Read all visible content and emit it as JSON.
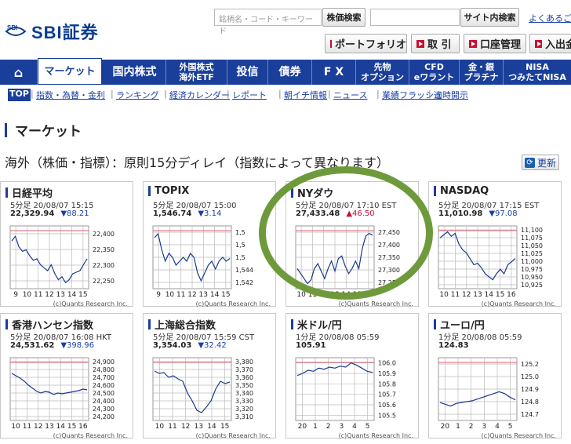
{
  "header": {
    "logo_text": "SBI証券",
    "logo_mark_text": "SBI",
    "search_placeholder": "銘柄名・コード・キーワード",
    "stock_search_button": "株価検索",
    "site_search_button": "サイト内検索",
    "link_text": "よくあるご",
    "quick_buttons": [
      "ポートフォリオ",
      "取 引",
      "口座管理",
      "入出金"
    ]
  },
  "nav": {
    "tabs": [
      {
        "label": "⌂"
      },
      {
        "label": "マーケット"
      },
      {
        "label": "国内株式"
      },
      {
        "label": "外国株式\n海外ETF"
      },
      {
        "label": "投信"
      },
      {
        "label": "債券"
      },
      {
        "label": "F X"
      },
      {
        "label": "先物\nオプション"
      },
      {
        "label": "CFD\neワラント"
      },
      {
        "label": "金・銀\nプラチナ"
      },
      {
        "label": "NISA\nつみたてNISA"
      }
    ],
    "subtabs": [
      "TOP",
      "指数・為替・金利",
      "ランキング",
      "経済カレンダー",
      "レポート",
      "朝イチ情報",
      "ニュース",
      "業績フラッシュ",
      "適時開示"
    ]
  },
  "section": {
    "title": "マーケット",
    "note": "海外（株価・指標）：原則15分ディレイ（指数によって異なります）",
    "update_button": "更新"
  },
  "colors": {
    "nav": "#1a3f9a",
    "down": "#1a3fa8",
    "up": "#c8102e",
    "line": "#1a3a8a",
    "ring": "#6e9a3b"
  },
  "cards": [
    {
      "title": "日経平均",
      "time": "5分足 20/08/07 15:15",
      "value": "22,329.94",
      "change": "▼88.21",
      "dir": "dn",
      "yticks": [
        "22,400",
        "22,350",
        "22,300",
        "22,250"
      ],
      "xticks": [
        "9",
        "10",
        "11",
        "12",
        "13",
        "14",
        "15"
      ],
      "credit": "(c)Quants Research Inc.",
      "chart_data": {
        "type": "line",
        "y": [
          22380,
          22395,
          22360,
          22345,
          22350,
          22330,
          22315,
          22320,
          22300,
          22290,
          22280,
          22300,
          22270,
          22250,
          22260,
          22240,
          22250,
          22270,
          22275,
          22280,
          22300,
          22320
        ],
        "ylim": [
          22220,
          22430
        ]
      }
    },
    {
      "title": "TOPIX",
      "time": "5分足 20/08/07 15:00",
      "value": "1,546.74",
      "change": "▼3.14",
      "dir": "dn",
      "yticks": [
        "1,5",
        "1,5",
        "1,5",
        "1,544",
        "1,542"
      ],
      "xticks": [
        "9",
        "10",
        "11",
        "12",
        "13",
        "14",
        "15"
      ],
      "credit": "(c)Quants Research Inc.",
      "chart_data": {
        "type": "line",
        "y": [
          1552,
          1553,
          1549,
          1546,
          1548,
          1547,
          1545,
          1546,
          1547,
          1546,
          1548,
          1547,
          1543,
          1541,
          1543,
          1545,
          1546,
          1544,
          1546,
          1547,
          1546,
          1546.7
        ],
        "ylim": [
          1539,
          1555
        ]
      }
    },
    {
      "title": "NYダウ",
      "time": "5分足 20/08/07 17:10 EST",
      "value": "27,433.48",
      "change": "▲46.50",
      "dir": "up",
      "yticks": [
        "27,450",
        "27,400",
        "27,350",
        "27,300",
        "27,250"
      ],
      "xticks": [
        "10",
        "11",
        "12",
        "13",
        "14",
        "15",
        "16"
      ],
      "credit": "(c)Quants Research Inc.",
      "chart_data": {
        "type": "line",
        "y": [
          27300,
          27280,
          27260,
          27240,
          27255,
          27300,
          27320,
          27290,
          27260,
          27300,
          27330,
          27290,
          27340,
          27350,
          27310,
          27280,
          27300,
          27330,
          27300,
          27380,
          27430,
          27440,
          27433
        ],
        "ylim": [
          27220,
          27470
        ]
      }
    },
    {
      "title": "NASDAQ",
      "time": "5分足 20/08/07 17:15 EST",
      "value": "11,010.98",
      "change": "▼97.08",
      "dir": "dn",
      "yticks": [
        "11,100",
        "11,075",
        "11,050",
        "11,025",
        "11,000",
        "10,975",
        "10,950",
        "10,925"
      ],
      "xticks": [
        "10",
        "11",
        "12",
        "13",
        "14",
        "15",
        "16"
      ],
      "credit": "(c)Quants Research Inc.",
      "chart_data": {
        "type": "line",
        "y": [
          11080,
          11090,
          11100,
          11085,
          11095,
          11060,
          11040,
          11030,
          11010,
          10990,
          10995,
          10980,
          10960,
          10950,
          10940,
          10960,
          10975,
          10960,
          10990,
          11000,
          11011
        ],
        "ylim": [
          10910,
          11120
        ]
      }
    },
    {
      "title": "香港ハンセン指数",
      "time": "5分足 20/08/07 16:08 HKT",
      "value": "24,531.62",
      "change": "▼398.96",
      "dir": "dn",
      "yticks": [
        "24,900",
        "24,800",
        "24,700",
        "24,600",
        "24,500",
        "24,400",
        "24,300",
        "24,200"
      ],
      "xticks": [
        "10",
        "11",
        "12",
        "13",
        "14",
        "15",
        "16"
      ],
      "credit": "(c)Quants Research Inc.",
      "chart_data": {
        "type": "line",
        "y": [
          24750,
          24720,
          24690,
          24650,
          24600,
          24560,
          24520,
          24500,
          24520,
          24510,
          24480,
          24500,
          24490,
          24500,
          24510,
          24520,
          24530,
          24550,
          24540
        ],
        "ylim": [
          24150,
          24950
        ]
      }
    },
    {
      "title": "上海総合指数",
      "time": "5分足 20/08/07 15:59 CST",
      "value": "3,354.03",
      "change": "▼32.42",
      "dir": "dn",
      "yticks": [
        "3,380",
        "3,370",
        "3,360",
        "3,350",
        "3,340",
        "3,330",
        "3,320",
        "3,310"
      ],
      "xticks": [
        "10",
        "11",
        "12",
        "13",
        "14",
        "15"
      ],
      "credit": "(c)Quants Research Inc.",
      "chart_data": {
        "type": "line",
        "y": [
          3368,
          3365,
          3366,
          3360,
          3362,
          3358,
          3355,
          3340,
          3330,
          3318,
          3315,
          3322,
          3330,
          3345,
          3355,
          3352,
          3354
        ],
        "ylim": [
          3305,
          3385
        ]
      }
    },
    {
      "title": "米ドル/円",
      "time": "1分足 20/08/08 05:59",
      "value": "105.91",
      "change": "",
      "dir": "dn",
      "yticks": [
        "106.0",
        "105.9",
        "105.8",
        "105.7",
        "105.6",
        "105.5"
      ],
      "xticks": [
        "20",
        "1",
        "2",
        "3",
        "4",
        "5"
      ],
      "credit": "(c)Quants Research Inc.",
      "chart_data": {
        "type": "line",
        "y": [
          105.88,
          105.9,
          105.93,
          105.92,
          105.95,
          105.94,
          105.96,
          105.95,
          105.97,
          105.96,
          106.0,
          105.98,
          105.95,
          105.92,
          105.91
        ],
        "ylim": [
          105.45,
          106.05
        ]
      }
    },
    {
      "title": "ユーロ/円",
      "time": "1分足 20/08/08 05:59",
      "value": "124.83",
      "change": "",
      "dir": "dn",
      "yticks": [
        "125.2",
        "125.0",
        "124.9",
        "124.8",
        "124.7"
      ],
      "xticks": [
        "20",
        "1",
        "2",
        "3",
        "4",
        "5"
      ],
      "credit": "(c)Quants Research Inc.",
      "chart_data": {
        "type": "line",
        "y": [
          124.8,
          124.78,
          124.76,
          124.79,
          124.8,
          124.81,
          124.82,
          124.84,
          124.86,
          124.88,
          124.9,
          124.92,
          124.9,
          124.86,
          124.83
        ],
        "ylim": [
          124.6,
          125.3
        ]
      }
    }
  ]
}
